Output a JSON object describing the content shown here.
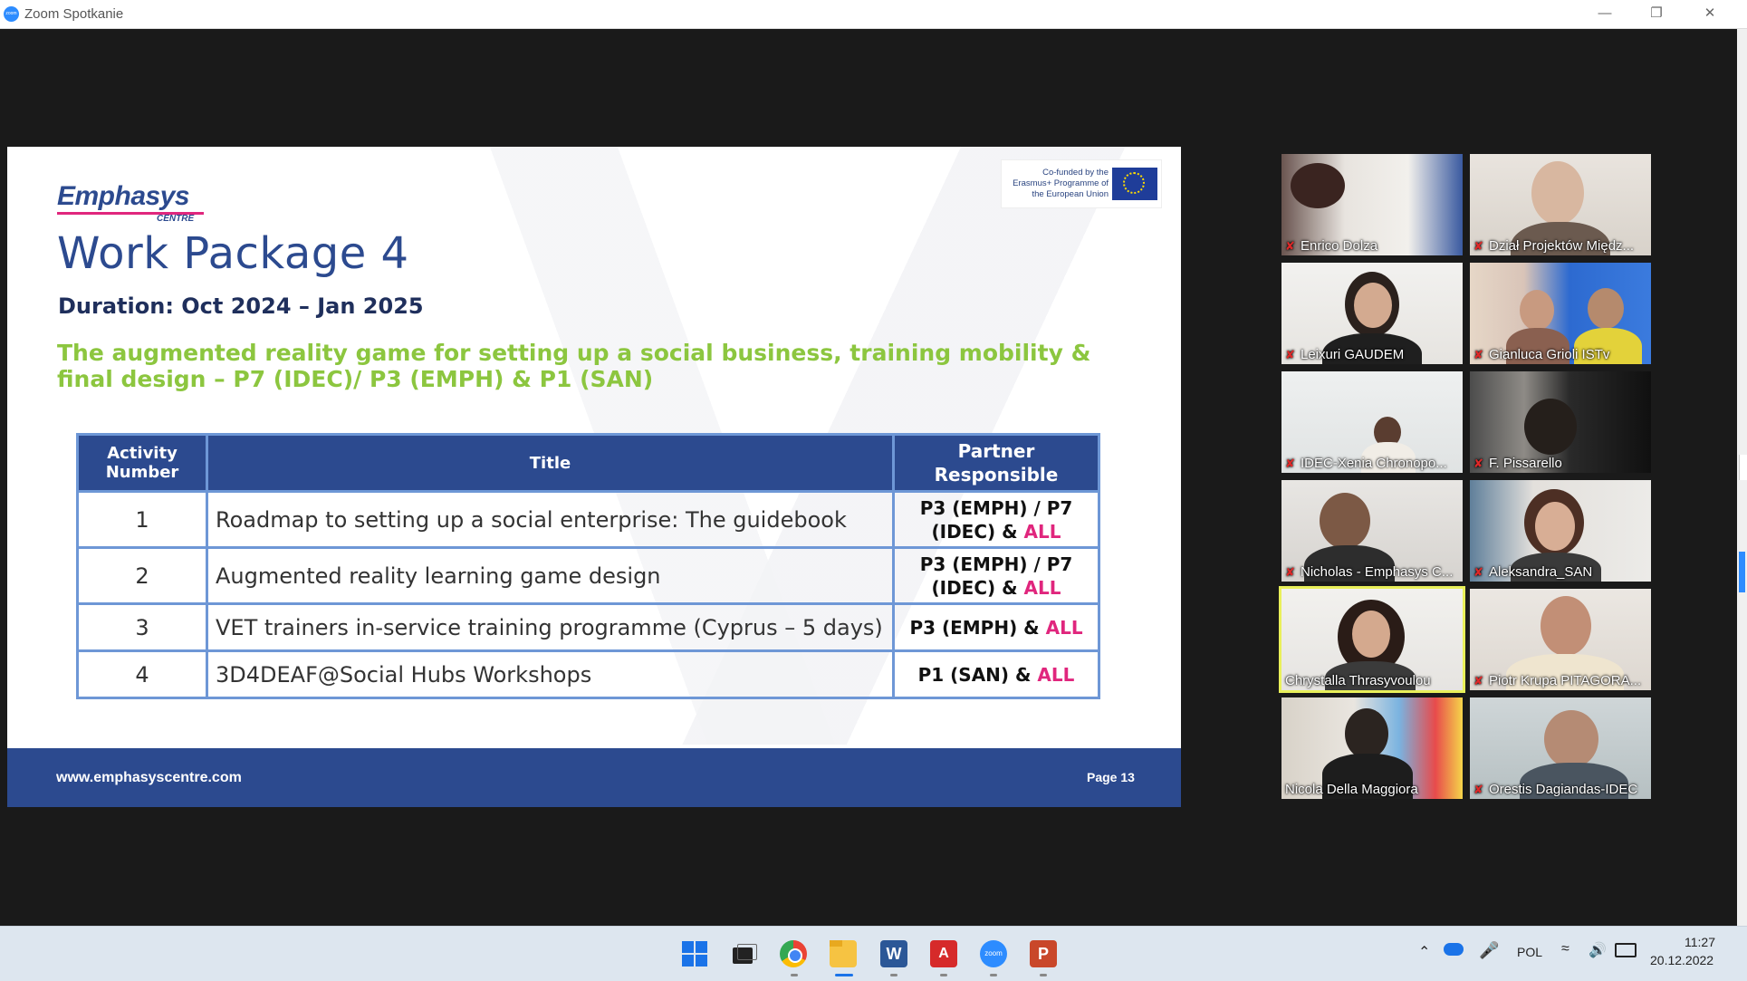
{
  "window": {
    "title": "Zoom Spotkanie",
    "icon_label": "zoom"
  },
  "slide": {
    "logo": "Emphasys",
    "logo_sub": "CENTRE",
    "eu_text": "Co-funded by the Erasmus+ Programme of the European Union",
    "title": "Work Package 4",
    "duration": "Duration: Oct 2024 – Jan 2025",
    "subtitle": "The augmented reality game for setting up a social business, training mobility & final design – P7 (IDEC)/ P3 (EMPH) & P1 (SAN)",
    "table": {
      "headers": [
        "Activity Number",
        "Title",
        "Partner Responsible"
      ],
      "rows": [
        {
          "num": "1",
          "title": "Roadmap to setting up a social enterprise: The guidebook",
          "partner": "P3 (EMPH) / P7 (IDEC) & ",
          "all": "ALL"
        },
        {
          "num": "2",
          "title": "Augmented reality learning game design",
          "partner": "P3 (EMPH) / P7 (IDEC) & ",
          "all": "ALL"
        },
        {
          "num": "3",
          "title": "VET trainers in-service training programme (Cyprus – 5 days)",
          "partner": "P3 (EMPH) & ",
          "all": "ALL"
        },
        {
          "num": "4",
          "title": "3D4DEAF@Social Hubs Workshops",
          "partner": "P1 (SAN) & ",
          "all": "ALL"
        }
      ]
    },
    "footer_url": "www.emphasyscentre.com",
    "footer_page": "Page 13"
  },
  "participants": [
    {
      "name": "Enrico Dolza",
      "muted": true
    },
    {
      "name": "Dział Projektów Międz...",
      "muted": true
    },
    {
      "name": "Leixuri GAUDEM",
      "muted": true
    },
    {
      "name": "Gianluca Grioli ISTv",
      "muted": true
    },
    {
      "name": "IDEC-Xenia Chronopo...",
      "muted": true
    },
    {
      "name": "F. Pissarello",
      "muted": true
    },
    {
      "name": "Nicholas - Emphasys C...",
      "muted": true
    },
    {
      "name": "Aleksandra_SAN",
      "muted": true
    },
    {
      "name": "Chrystalla Thrasyvoulou",
      "muted": false,
      "speaking": true
    },
    {
      "name": "Piotr Krupa PITAGORA...",
      "muted": true
    },
    {
      "name": "Nicola Della Maggiora",
      "muted": false
    },
    {
      "name": "Orestis Dagiandas-IDEC",
      "muted": true
    }
  ],
  "taskbar": {
    "apps": [
      "start-icon",
      "task-view-icon",
      "chrome-icon",
      "file-explorer-icon",
      "word-icon",
      "acrobat-icon",
      "zoom-icon",
      "powerpoint-icon"
    ],
    "language": "POL",
    "time": "11:27",
    "date": "20.12.2022"
  }
}
